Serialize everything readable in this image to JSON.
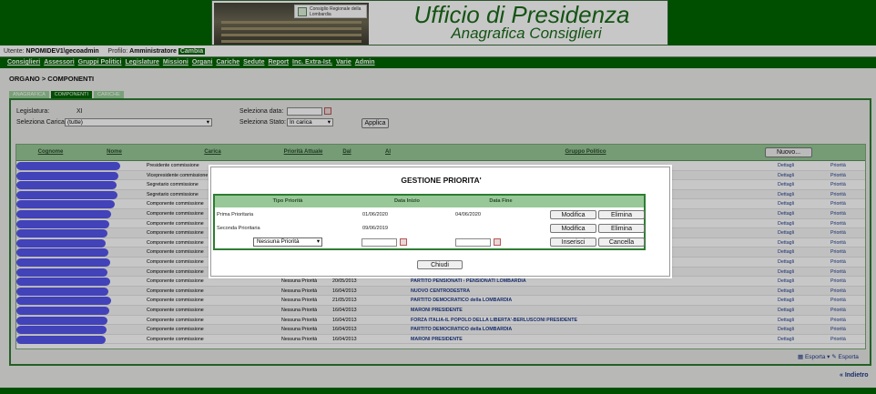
{
  "header": {
    "title": "Ufficio di Presidenza",
    "subtitle": "Anagrafica Consiglieri",
    "logo_text": "Consiglio Regionale della Lombardia"
  },
  "user": {
    "utente_label": "Utente:",
    "utente_value": "NPOMIDEV1\\gecoadmin",
    "profilo_label": "Profilo:",
    "profilo_value": "Amministratore",
    "cambia": "Cambia"
  },
  "menu": [
    "Consiglieri",
    "Assessori",
    "Gruppi Politici",
    "Legislature",
    "Missioni",
    "Organi",
    "Cariche",
    "Sedute",
    "Report",
    "Inc. Extra-Ist.",
    "Varie",
    "Admin"
  ],
  "breadcrumb": "ORGANO > COMPONENTI",
  "tabs": [
    "ANAGRAFICA",
    "COMPONENTI",
    "CARICHE"
  ],
  "filters": {
    "legislatura_label": "Legislatura:",
    "legislatura_value": "XI",
    "carica_label": "Seleziona Carica:",
    "carica_value": "(tutte)",
    "data_label": "Seleziona data:",
    "stato_label": "Seleziona Stato:",
    "stato_value": "In carica",
    "applica": "Applica"
  },
  "grid": {
    "headers": [
      "Cognome",
      "Nome",
      "Carica",
      "Priorità Attuale",
      "Dal",
      "Al",
      "Gruppo Politico"
    ],
    "nuovo": "Nuovo...",
    "dettagli": "Dettagli",
    "priorita": "Priorità",
    "rows": [
      {
        "carica": "Presidente commissione",
        "priorita": "",
        "dal": "",
        "gruppo": ""
      },
      {
        "carica": "Vicepresidente commissione",
        "priorita": "",
        "dal": "",
        "gruppo": ""
      },
      {
        "carica": "Segretario commissione",
        "priorita": "",
        "dal": "",
        "gruppo": ""
      },
      {
        "carica": "Segretario commissione",
        "priorita": "",
        "dal": "",
        "gruppo": ""
      },
      {
        "carica": "Componente commissione",
        "priorita": "",
        "dal": "",
        "gruppo": ""
      },
      {
        "carica": "Componente commissione",
        "priorita": "",
        "dal": "",
        "gruppo": ""
      },
      {
        "carica": "Componente commissione",
        "priorita": "",
        "dal": "",
        "gruppo": ""
      },
      {
        "carica": "Componente commissione",
        "priorita": "",
        "dal": "",
        "gruppo": ""
      },
      {
        "carica": "Componente commissione",
        "priorita": "",
        "dal": "",
        "gruppo": ""
      },
      {
        "carica": "Componente commissione",
        "priorita": "",
        "dal": "",
        "gruppo": ""
      },
      {
        "carica": "Componente commissione",
        "priorita": "",
        "dal": "",
        "gruppo": ""
      },
      {
        "carica": "Componente commissione",
        "priorita": "",
        "dal": "",
        "gruppo": ""
      },
      {
        "carica": "Componente commissione",
        "priorita": "Nessuna Priorità",
        "dal": "20/05/2013",
        "gruppo": "PARTITO PENSIONATI - PENSIONATI LOMBARDIA"
      },
      {
        "carica": "Componente commissione",
        "priorita": "Nessuna Priorità",
        "dal": "16/04/2013",
        "gruppo": "NUOVO CENTRODESTRA"
      },
      {
        "carica": "Componente commissione",
        "priorita": "Nessuna Priorità",
        "dal": "21/05/2013",
        "gruppo": "PARTITO DEMOCRATICO della LOMBARDIA"
      },
      {
        "carica": "Componente commissione",
        "priorita": "Nessuna Priorità",
        "dal": "16/04/2013",
        "gruppo": "MARONI PRESIDENTE"
      },
      {
        "carica": "Componente commissione",
        "priorita": "Nessuna Priorità",
        "dal": "16/04/2013",
        "gruppo": "FORZA ITALIA-IL POPOLO DELLA LIBERTA'-BERLUSCONI PRESIDENTE"
      },
      {
        "carica": "Componente commissione",
        "priorita": "Nessuna Priorità",
        "dal": "16/04/2013",
        "gruppo": "PARTITO DEMOCRATICO della LOMBARDIA"
      },
      {
        "carica": "Componente commissione",
        "priorita": "Nessuna Priorità",
        "dal": "16/04/2013",
        "gruppo": "MARONI PRESIDENTE"
      }
    ]
  },
  "modal": {
    "title": "GESTIONE PRIORITA'",
    "headers": [
      "Tipo Priorità",
      "Data Inizio",
      "Data Fine"
    ],
    "rows": [
      {
        "tipo": "Prima Prioritaria",
        "inizio": "01/06/2020",
        "fine": "04/06/2020"
      },
      {
        "tipo": "Seconda Prioritaria",
        "inizio": "09/06/2019",
        "fine": ""
      }
    ],
    "new_select": "Nessuna Priorità",
    "modifica": "Modifica",
    "elimina": "Elimina",
    "inserisci": "Inserisci",
    "cancella": "Cancella",
    "chiudi": "Chiudi"
  },
  "footer": {
    "esporta1": "Esporta",
    "esporta2": "Esporta",
    "indietro": "« Indietro"
  },
  "colors": {
    "brand_green": "#006400",
    "header_green": "#98c898",
    "link_blue": "#1f3a8a",
    "redaction": "#5555ee"
  }
}
